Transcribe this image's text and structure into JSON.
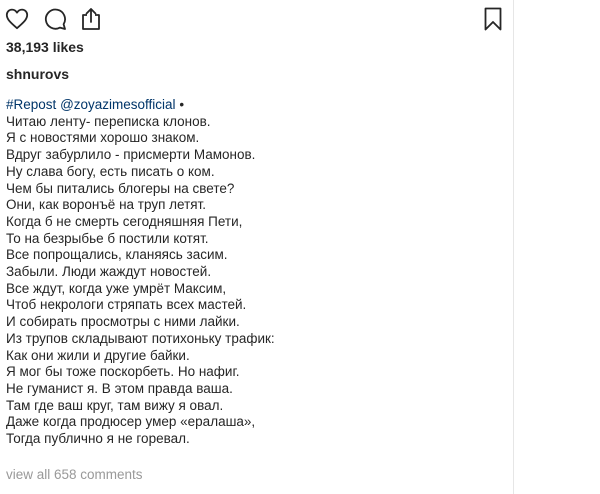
{
  "post": {
    "likes": "38,193 likes",
    "author": "shnurovs",
    "caption": {
      "hashtag": "#Repost",
      "mention": "@zoyazimesofficial",
      "first_line_suffix": " •",
      "lines": [
        "Читаю ленту- переписка клонов.",
        "Я с новостями хорошо знаком.",
        "Вдруг забурлило - присмерти Мамонов.",
        "Ну слава богу, есть писать о ком.",
        "Чем бы питались блогеры на свете?",
        "Они, как воронъё на труп летят.",
        "Когда б не смерть сегодняшняя Пети,",
        "То на безрыбье б постили котят.",
        "Все попрощались, кланяясь засим.",
        "Забыли. Люди жаждут новостей.",
        "Все ждут, когда уже умрёт Максим,",
        "Чтоб некрологи стряпать всех мастей.",
        "И собирать просмотры с ними лайки.",
        "Из трупов складывают потихоньку трафик:",
        "Как они жили и другие байки.",
        "Я мог бы тоже поскорбеть. Но нафиг.",
        "Не гуманист я. В этом правда ваша.",
        "Там где ваш круг, там вижу я овал.",
        "Даже когда продюсер умер «ералаша»,",
        "Тогда публично я не горевал."
      ]
    },
    "view_comments": "view all 658 comments"
  },
  "icons": {
    "like": "heart-icon",
    "comment": "comment-icon",
    "share": "share-icon",
    "save": "bookmark-icon"
  },
  "colors": {
    "text": "#262626",
    "link": "#003569",
    "muted": "#999999"
  }
}
